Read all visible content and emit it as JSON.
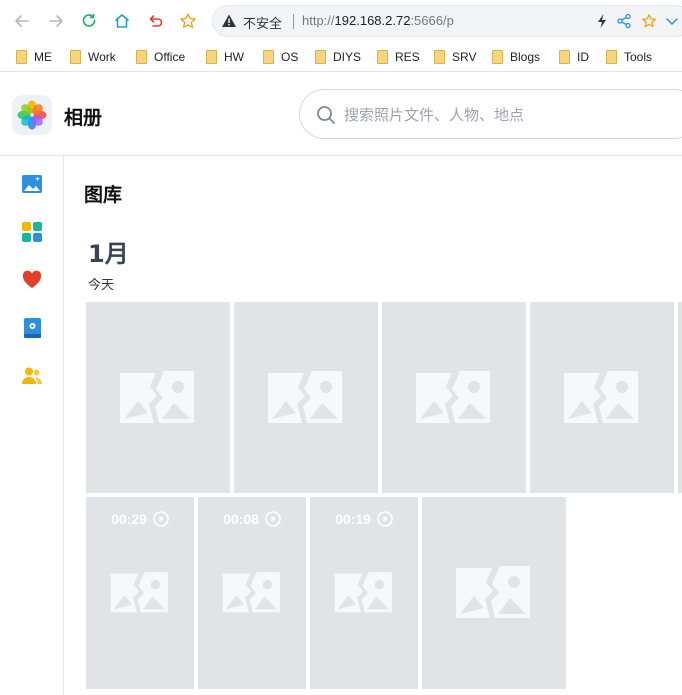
{
  "browser": {
    "address": {
      "security_label": "不安全",
      "url_scheme": "http://",
      "url_host": "192.168.2.72",
      "url_rest": ":5666/p"
    },
    "bookmarks": [
      {
        "label": "ME"
      },
      {
        "label": "Work"
      },
      {
        "label": "Office"
      },
      {
        "label": "HW"
      },
      {
        "label": "OS"
      },
      {
        "label": "DIYS"
      },
      {
        "label": "RES"
      },
      {
        "label": "SRV"
      },
      {
        "label": "Blogs"
      },
      {
        "label": "ID"
      },
      {
        "label": "Tools"
      }
    ]
  },
  "app": {
    "title": "相册",
    "search_placeholder": "搜索照片文件、人物、地点",
    "sidebar_icons": [
      "gallery-icon",
      "albums-icon",
      "favorites-icon",
      "collection-icon",
      "people-icon"
    ],
    "colors": {
      "accent_blue": "#2e8fe0",
      "favorite_red": "#e0412f",
      "people_yellow": "#f2b705",
      "albums_teal": "#18b8a0",
      "tile_bg": "#e1e3e7"
    }
  },
  "gallery": {
    "title": "图库",
    "month": "1月",
    "day_label": "今天",
    "videos": [
      {
        "duration": "00:29"
      },
      {
        "duration": "00:08"
      },
      {
        "duration": "00:19"
      }
    ]
  }
}
